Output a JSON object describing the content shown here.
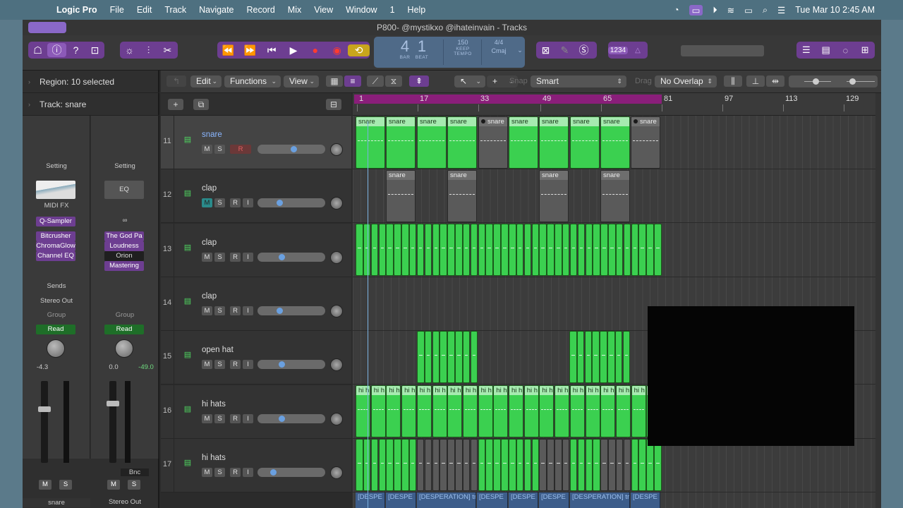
{
  "menubar": {
    "app": "Logic Pro",
    "items": [
      "File",
      "Edit",
      "Track",
      "Navigate",
      "Record",
      "Mix",
      "View",
      "Window",
      "1",
      "Help"
    ],
    "datetime": "Tue Mar 10  2:45 AM"
  },
  "window": {
    "title": "P800- @mystikxo @ihateinvain - Tracks"
  },
  "lcd": {
    "bar": "4",
    "beat": "1",
    "bar_label": "BAR",
    "beat_label": "BEAT",
    "tempo": "150",
    "keep": "KEEP",
    "tempo_label": "TEMPO",
    "sig": "4/4",
    "key": "Cmaj"
  },
  "keybadge": "1234",
  "inspector": {
    "region": "Region: 10 selected",
    "track": "Track:  snare"
  },
  "strips": [
    {
      "setting": "Setting",
      "midifx": "MIDI FX",
      "instrument": "Q-Sampler",
      "plugins": [
        "Bitcrusher",
        "ChromaGlow",
        "Channel EQ"
      ],
      "sends": "Sends",
      "output": "Stereo Out",
      "group": "Group",
      "automation": "Read",
      "vol": "-4.3",
      "peak": "",
      "m": "M",
      "s": "S",
      "name": "snare"
    },
    {
      "setting": "Setting",
      "eq": "EQ",
      "plugins": [
        "The God Pa",
        "Loudness",
        "Orion",
        "Mastering"
      ],
      "group": "Group",
      "automation": "Read",
      "vol": "0.0",
      "peak": "-49.0",
      "bnc": "Bnc",
      "m": "M",
      "s": "S",
      "name": "Stereo Out"
    }
  ],
  "editbar": {
    "edit": "Edit",
    "functions": "Functions",
    "view": "View",
    "snap_label": "Snap",
    "snap": "Smart",
    "drag_label": "Drag",
    "drag": "No Overlap"
  },
  "ruler": [
    "1",
    "17",
    "33",
    "49",
    "65",
    "81",
    "97",
    "113",
    "129"
  ],
  "tracks": [
    {
      "num": "11",
      "name": "snare",
      "selected": true
    },
    {
      "num": "12",
      "name": "clap",
      "muted": true
    },
    {
      "num": "13",
      "name": "clap"
    },
    {
      "num": "14",
      "name": "clap"
    },
    {
      "num": "15",
      "name": "open hat"
    },
    {
      "num": "16",
      "name": "hi hats"
    },
    {
      "num": "17",
      "name": "hi hats"
    }
  ],
  "track_buttons": {
    "m": "M",
    "s": "S",
    "r": "R",
    "i": "I"
  },
  "regions": {
    "snare": "snare",
    "hihat": "hi h",
    "desp": [
      "[DESPE",
      "[DESPE",
      "[DESPERATION] tr",
      "[DESPE",
      "[DESPE",
      "[DESPE",
      "[DESPERATION] tr",
      "[DESPE"
    ]
  }
}
